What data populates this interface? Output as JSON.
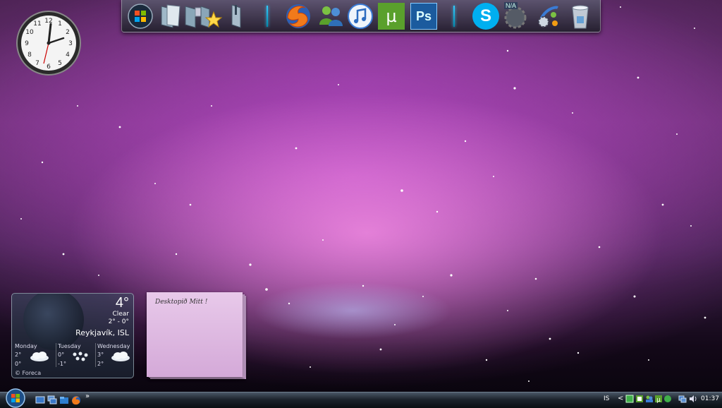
{
  "desktop": {
    "dock": {
      "items": [
        {
          "name": "start-orb-icon"
        },
        {
          "name": "documents-icon"
        },
        {
          "name": "pictures-icon"
        },
        {
          "name": "favorites-icon"
        },
        {
          "name": "tools-icon"
        },
        {
          "name": "firefox-icon"
        },
        {
          "name": "messenger-icon"
        },
        {
          "name": "itunes-icon"
        },
        {
          "name": "utorrent-icon",
          "glyph": "µ"
        },
        {
          "name": "photoshop-icon",
          "glyph": "Ps"
        },
        {
          "name": "skype-icon",
          "glyph": "S"
        },
        {
          "name": "na-icon",
          "glyph": "N/A"
        },
        {
          "name": "settings-icon"
        },
        {
          "name": "recycle-bin-icon"
        }
      ]
    },
    "weather": {
      "temperature": "4°",
      "condition": "Clear",
      "range": "2° - 0°",
      "city": "Reykjavík, ISL",
      "forecast": [
        {
          "day": "Monday",
          "high": "2°",
          "low": "0°"
        },
        {
          "day": "Tuesday",
          "high": "0°",
          "low": "-1°"
        },
        {
          "day": "Wednesday",
          "high": "3°",
          "low": "2°"
        }
      ],
      "credit": "© Foreca"
    },
    "sticky_note": {
      "text": "Desktopið Mitt !"
    }
  },
  "taskbar": {
    "language": "IS",
    "time": "01:37",
    "chevron": "»",
    "tray_chevron": "<"
  },
  "colors": {
    "accent": "#33ccff",
    "note": "#e8c9ea",
    "utorrent": "#5aa02c",
    "photoshop": "#1b5b9e",
    "skype": "#00aff0"
  }
}
